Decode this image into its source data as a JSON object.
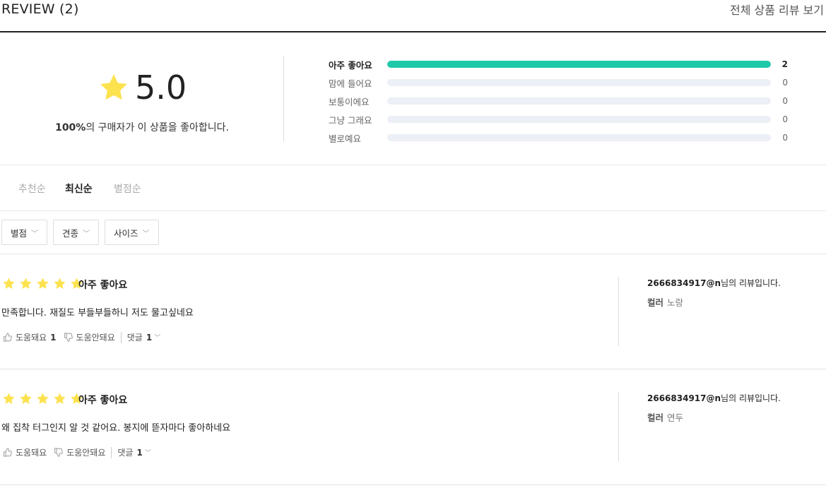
{
  "header": {
    "title": "REVIEW (2)",
    "all_link": "전체 상품 리뷰 보기"
  },
  "summary": {
    "score": "5.0",
    "percent": "100%",
    "percent_suffix": "의 구매자가 이 상품을 좋아합니다.",
    "star_color": "#fde24f",
    "distribution": [
      {
        "label": "아주 좋아요",
        "count": "2",
        "fraction": 1.0
      },
      {
        "label": "맘에 들어요",
        "count": "0",
        "fraction": 0
      },
      {
        "label": "보통이에요",
        "count": "0",
        "fraction": 0
      },
      {
        "label": "그냥 그래요",
        "count": "0",
        "fraction": 0
      },
      {
        "label": "별로예요",
        "count": "0",
        "fraction": 0
      }
    ],
    "bar_color": "#1fc9a9"
  },
  "sort": {
    "recommended": "추천순",
    "latest": "최신순",
    "rating": "별점순"
  },
  "filters": {
    "rating": "별점",
    "breed": "견종",
    "size": "사이즈"
  },
  "reviews": [
    {
      "stars": 5,
      "rating_text": "아주 좋아요",
      "body": "만족합니다. 재질도 부들부들하니 저도 물고싶네요",
      "helpful_label": "도움돼요",
      "helpful_count": "1",
      "unhelpful_label": "도움안돼요",
      "comment_label": "댓글",
      "comment_count": "1",
      "author_id": "2666834917@n",
      "author_suffix": "님의 리뷰입니다.",
      "option_label": "컬러",
      "option_value": "노랑"
    },
    {
      "stars": 5,
      "rating_text": "아주 좋아요",
      "body": "왜 집착 터그인지 알 것 같어요. 봉지에 뜯자마다 좋아하네요",
      "helpful_label": "도움돼요",
      "helpful_count": "",
      "unhelpful_label": "도움안돼요",
      "comment_label": "댓글",
      "comment_count": "1",
      "author_id": "2666834917@n",
      "author_suffix": "님의 리뷰입니다.",
      "option_label": "컬러",
      "option_value": "연두"
    }
  ]
}
